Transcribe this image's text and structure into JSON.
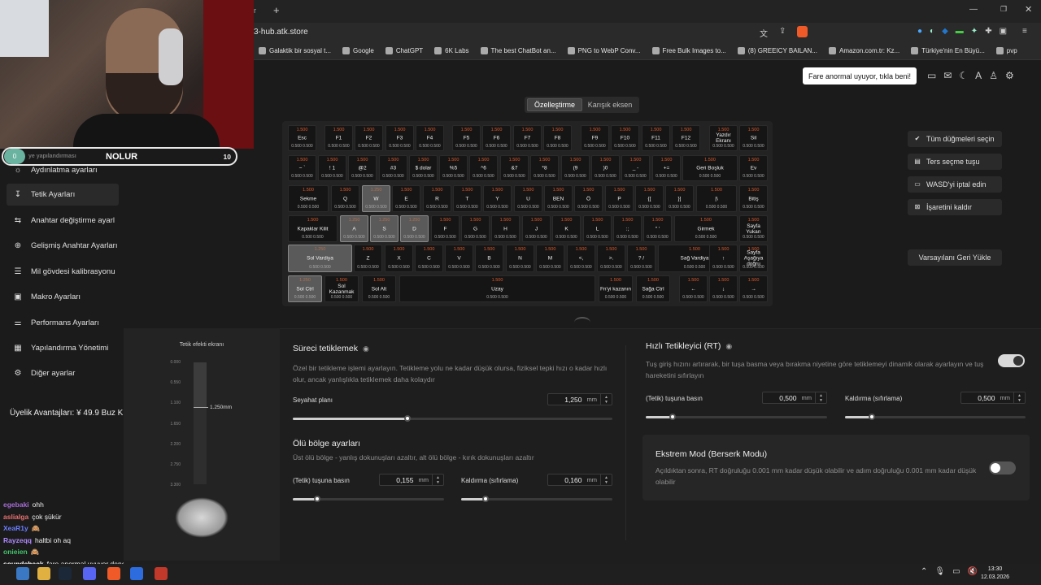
{
  "browser": {
    "tab_partial": "r",
    "url": "3-hub.atk.store",
    "bookmarks": [
      {
        "label": "Galaktik bir sosyal t...",
        "icon": "zk-icon"
      },
      {
        "label": "Google",
        "icon": "google-icon"
      },
      {
        "label": "ChatGPT",
        "icon": "chatgpt-icon"
      },
      {
        "label": "6K Labs",
        "icon": "6k-icon"
      },
      {
        "label": "The best ChatBot an...",
        "icon": "bot-icon"
      },
      {
        "label": "PNG to WebP Conv...",
        "icon": "png-icon"
      },
      {
        "label": "Free Bulk Images to...",
        "icon": "leaf-icon"
      },
      {
        "label": "(8) GREEICY BAILAN...",
        "icon": "youtube-icon"
      },
      {
        "label": "Amazon.com.tr: Kz...",
        "icon": "amazon-icon"
      },
      {
        "label": "Türkiye'nin En Büyü...",
        "icon": "shop-icon"
      },
      {
        "label": "pvp",
        "icon": "fire-icon"
      }
    ]
  },
  "notice": "Fare anormal uyuyor, tıkla beni!",
  "overlay": {
    "badge": "0",
    "ghost": "ye yapılandırması",
    "title": "NOLUR",
    "count": "10"
  },
  "sidebar": {
    "items": [
      {
        "label": "Aydınlatma ayarları",
        "icon": "sun-icon"
      },
      {
        "label": "Tetik Ayarları",
        "icon": "trigger-icon"
      },
      {
        "label": "Anahtar değiştirme ayarl",
        "icon": "swap-icon"
      },
      {
        "label": "Gelişmiş Anahtar Ayarları",
        "icon": "advanced-key-icon"
      },
      {
        "label": "Mil gövdesi kalibrasyonu",
        "icon": "calibration-icon"
      },
      {
        "label": "Makro Ayarları",
        "icon": "macro-icon"
      },
      {
        "label": "Performans Ayarları",
        "icon": "performance-icon"
      },
      {
        "label": "Yapılandırma Yönetimi",
        "icon": "config-icon"
      },
      {
        "label": "Diğer ayarlar",
        "icon": "settings-icon"
      }
    ],
    "membership": "Üyelik Avantajları: ¥ 49.9 Buz Ku."
  },
  "chat": [
    {
      "user": "egebaki",
      "color": "#a76bd6",
      "text": "ohh"
    },
    {
      "user": "aslialga",
      "color": "#e87070",
      "text": "çok şükür"
    },
    {
      "user": "XeaR1y",
      "color": "#6a7cff",
      "text": "🙈"
    },
    {
      "user": "Rayzeqq",
      "color": "#b08aff",
      "text": "haltbi oh aq"
    },
    {
      "user": "onieien",
      "color": "#43c46b",
      "text": "🙈"
    },
    {
      "user": "soundcheck",
      "color": "#ffffff",
      "text": "fare anormal uyuyor dene beni"
    }
  ],
  "mode_tabs": {
    "customize": "Özelleştirme",
    "mixed": "Karışık eksen"
  },
  "right_buttons": {
    "select_all": "Tüm düğmeleri seçin",
    "invert": "Ters seçme tuşu",
    "wasd": "WASD'yi iptal edin",
    "unmark": "İşaretini kaldır",
    "restore": "Varsayılanı Geri Yükle"
  },
  "keyboard": {
    "top_default": "1.500",
    "bottom_default": "0.500  0.500",
    "top_selected": "1.250",
    "rows": [
      [
        "Esc",
        "F1",
        "F2",
        "F3",
        "F4",
        "F5",
        "F6",
        "F7",
        "F8",
        "F9",
        "F10",
        "F11",
        "F12",
        "Yazdır Ekranı",
        "Sil"
      ],
      [
        "~ `",
        "! 1",
        "@2",
        "#3",
        "$ dolar",
        "%5",
        "^6",
        "&7",
        "*8",
        "(9",
        ")0",
        "_ -",
        "+=",
        "Geri Boşluk",
        "Ev"
      ],
      [
        "Sekme",
        "Q",
        "W",
        "E",
        "R",
        "T",
        "Y",
        "U",
        "BEN",
        "Ö",
        "P",
        "{[",
        "}]",
        "|\\",
        "Bitiş"
      ],
      [
        "Kapaklar Kilit",
        "A",
        "S",
        "D",
        "F",
        "G",
        "H",
        "J",
        "K",
        "L",
        ":;",
        "\" '",
        "Girmek",
        "Sayfa Yukarı"
      ],
      [
        "Sol Vardiya",
        "Z",
        "X",
        "C",
        "V",
        "B",
        "N",
        "M",
        "<,",
        ">.",
        "? /",
        "Sağ Vardiya",
        "↑",
        "Sayfa Aşağıya doğru"
      ],
      [
        "Sol Ctrl",
        "Sol Kazanmak",
        "Sol Alt",
        "Uzay",
        "Fn'yi kazanın",
        "Sağa Ctrl",
        "←",
        "↓",
        "→"
      ]
    ]
  },
  "visual": {
    "title": "Tetik efekti ekranı",
    "ticks": [
      "0.000",
      "0.550",
      "1.100",
      "1.650",
      "2.200",
      "2.750",
      "3.300"
    ],
    "value": "1.250mm"
  },
  "continuous": {
    "title": "Süreci tetiklemek",
    "desc": "Özel bir tetikleme işlemi ayarlayın. Tetikleme yolu ne kadar düşük olursa, fiziksel tepki hızı o kadar hızlı olur, ancak yanlışlıkla tetiklemek daha kolaydır",
    "travel_label": "Seyahat planı",
    "travel_value": "1,250",
    "unit": "mm",
    "travel_fraction": 0.36
  },
  "deadzone": {
    "title": "Ölü bölge ayarları",
    "desc": "Üst ölü bölge - yanlış dokunuşları azaltır, alt ölü bölge - kırık dokunuşları azaltır",
    "press_label": "(Tetik) tuşuna basın",
    "press_value": "0,155",
    "release_label": "Kaldırma (sıfırlama)",
    "release_value": "0,160",
    "press_fraction": 0.16,
    "release_fraction": 0.16
  },
  "rapid": {
    "title": "Hızlı Tetikleyici (RT)",
    "desc": "Tuş giriş hızını artırarak, bir tuşa basma veya bırakma niyetine göre tetiklemeyi dinamik olarak ayarlayın ve tuş hareketini sıfırlayın",
    "press_label": "(Tetik) tuşuna basın",
    "press_value": "0,500",
    "release_label": "Kaldırma (sıfırlama)",
    "release_value": "0,500",
    "enabled": true,
    "press_fraction": 0.15,
    "release_fraction": 0.15
  },
  "berserk": {
    "title": "Ekstrem Mod (Berserk Modu)",
    "desc": "Açıldıktan sonra, RT doğruluğu 0.001 mm kadar düşük olabilir ve adım doğruluğu 0.001 mm kadar düşük olabilir",
    "enabled": false
  },
  "taskbar": {
    "time": "13:30",
    "date": "12.03.2026"
  }
}
